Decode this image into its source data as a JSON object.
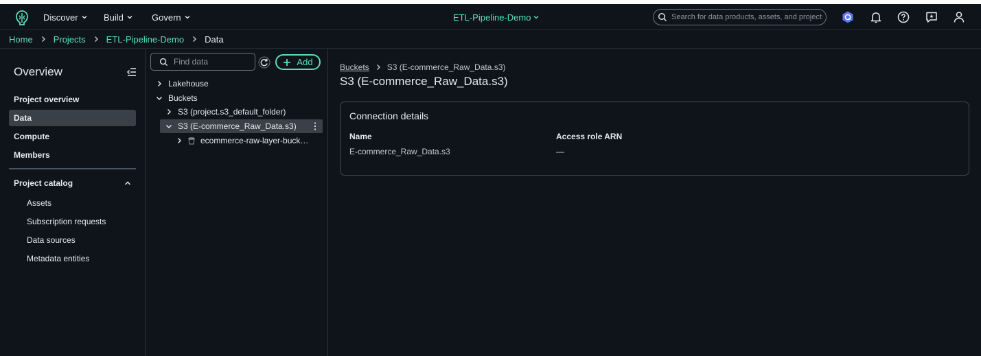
{
  "topnav": {
    "menus": [
      "Discover",
      "Build",
      "Govern"
    ],
    "project": "ETL-Pipeline-Demo",
    "search_placeholder": "Search for data products, assets, and projects"
  },
  "breadcrumb": {
    "items": [
      "Home",
      "Projects",
      "ETL-Pipeline-Demo"
    ],
    "current": "Data"
  },
  "sidebar": {
    "title": "Overview",
    "items": [
      "Project overview",
      "Data",
      "Compute",
      "Members"
    ],
    "active": "Data",
    "catalog": {
      "label": "Project catalog",
      "items": [
        "Assets",
        "Subscription requests",
        "Data sources",
        "Metadata entities"
      ]
    }
  },
  "tree": {
    "find_placeholder": "Find data",
    "add_label": "Add",
    "nodes": {
      "lakehouse": "Lakehouse",
      "buckets": "Buckets",
      "default_folder": "S3 (project.s3_default_folder)",
      "ecommerce": "S3 (E-commerce_Raw_Data.s3)",
      "raw_layer": "ecommerce-raw-layer-buck…"
    }
  },
  "main": {
    "crumb_link": "Buckets",
    "crumb_current": "S3 (E-commerce_Raw_Data.s3)",
    "title": "S3 (E-commerce_Raw_Data.s3)",
    "card": {
      "title": "Connection details",
      "name_label": "Name",
      "name_value": "E-commerce_Raw_Data.s3",
      "arn_label": "Access role ARN",
      "arn_value": "—"
    }
  },
  "colors": {
    "accent": "#5ae0b8",
    "background": "#0f141a",
    "selected": "#3a4048"
  }
}
